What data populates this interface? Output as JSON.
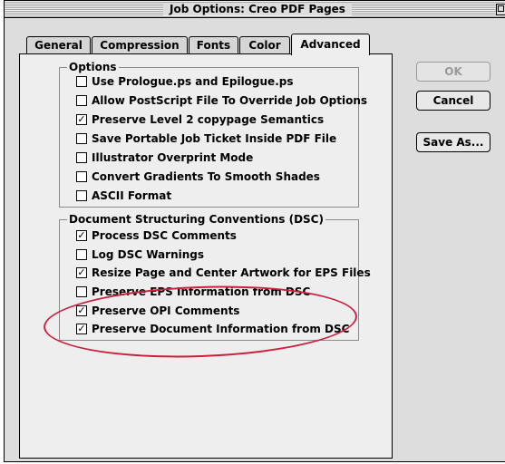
{
  "window": {
    "title": "Job Options: Creo PDF Pages"
  },
  "tabs": [
    {
      "label": "General"
    },
    {
      "label": "Compression"
    },
    {
      "label": "Fonts"
    },
    {
      "label": "Color"
    },
    {
      "label": "Advanced",
      "active": true
    }
  ],
  "options_group": {
    "title": "Options",
    "items": [
      {
        "label": "Use Prologue.ps and Epilogue.ps",
        "checked": false
      },
      {
        "label": "Allow PostScript File To Override Job Options",
        "checked": false
      },
      {
        "label": "Preserve Level 2 copypage Semantics",
        "checked": true
      },
      {
        "label": "Save Portable Job Ticket Inside PDF File",
        "checked": false
      },
      {
        "label": "Illustrator Overprint Mode",
        "checked": false
      },
      {
        "label": "Convert Gradients To Smooth Shades",
        "checked": false
      },
      {
        "label": "ASCII Format",
        "checked": false
      }
    ]
  },
  "dsc_group": {
    "title": "Document Structuring Conventions (DSC)",
    "items": [
      {
        "label": "Process DSC Comments",
        "checked": true
      },
      {
        "label": "Log DSC Warnings",
        "checked": false
      },
      {
        "label": "Resize Page and Center Artwork for EPS Files",
        "checked": true
      },
      {
        "label": "Preserve EPS Information from DSC",
        "checked": false
      },
      {
        "label": "Preserve OPI Comments",
        "checked": true
      },
      {
        "label": "Preserve Document Information from DSC",
        "checked": true
      }
    ]
  },
  "buttons": {
    "ok": "OK",
    "cancel": "Cancel",
    "save_as": "Save As..."
  },
  "annotation_color": "#cc1f3d",
  "check_glyph": "✓"
}
